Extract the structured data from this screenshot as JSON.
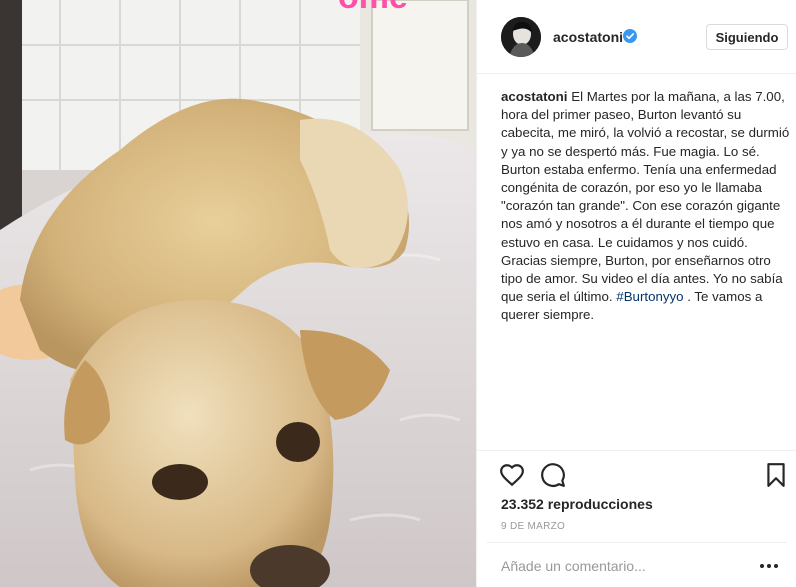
{
  "post": {
    "username": "acostatoni",
    "follow_label": "Siguiendo",
    "caption": {
      "user": "acostatoni",
      "text": " El Martes por la mañana, a las 7.00, hora del primer paseo, Burton levantó su cabecita, me miró, la volvió a recostar, se durmió y ya no se despertó más. Fue magia. Lo sé. Burton estaba enfermo. Tenía una enfermedad congénita de corazón, por eso yo le llamaba \"corazón tan grande\". Con ese corazón gigante nos amó y nosotros a él durante el tiempo que estuvo en casa. Le cuidamos y nos cuidó. Gracias siempre, Burton, por enseñarnos otro tipo de amor. Su video el día antes. Yo no sabía que seria el último. ",
      "hashtag": "#Burtonyyo",
      "tail": " . Te vamos a querer siempre."
    },
    "views": "23.352 reproducciones",
    "date": "9 DE MARZO",
    "comment_placeholder": "Añade un comentario...",
    "icons": {
      "like": "heart-outline-icon",
      "comment": "speech-bubble-icon",
      "save": "bookmark-outline-icon",
      "verified": "verified-badge-icon",
      "more": "ellipsis-icon"
    },
    "colors": {
      "verified": "#3897f0",
      "hashtag": "#003569",
      "overlay_text": "#ff4fa8"
    }
  }
}
